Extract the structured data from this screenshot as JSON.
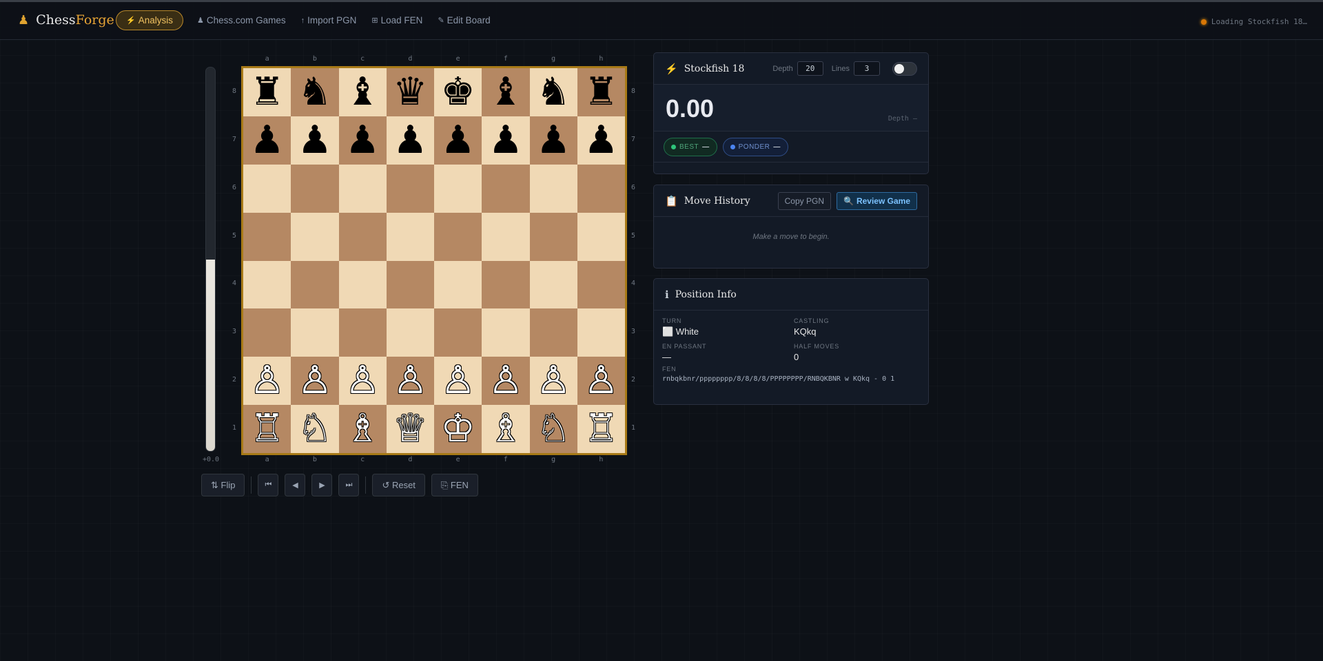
{
  "nav": {
    "brand_icon": "♟",
    "brand_prefix": "Chess",
    "brand_accent": "Forge",
    "items": [
      {
        "icon": "⚡",
        "label": "Analysis"
      },
      {
        "icon": "♟",
        "label": "Chess.com Games"
      },
      {
        "icon": "↑",
        "label": "Import PGN"
      },
      {
        "icon": "⊞",
        "label": "Load FEN"
      },
      {
        "icon": "✎",
        "label": "Edit Board"
      }
    ],
    "status_text": "Loading Stockfish 18…"
  },
  "eval_bar": {
    "white_fraction": 0.5,
    "label": "+0.0"
  },
  "board": {
    "files": [
      "a",
      "b",
      "c",
      "d",
      "e",
      "f",
      "g",
      "h"
    ],
    "ranks": [
      "8",
      "7",
      "6",
      "5",
      "4",
      "3",
      "2",
      "1"
    ],
    "rows": [
      [
        "♜",
        "♞",
        "♝",
        "♛",
        "♚",
        "♝",
        "♞",
        "♜"
      ],
      [
        "♟",
        "♟",
        "♟",
        "♟",
        "♟",
        "♟",
        "♟",
        "♟"
      ],
      [
        "",
        "",
        "",
        "",
        "",
        "",
        "",
        ""
      ],
      [
        "",
        "",
        "",
        "",
        "",
        "",
        "",
        ""
      ],
      [
        "",
        "",
        "",
        "",
        "",
        "",
        "",
        ""
      ],
      [
        "",
        "",
        "",
        "",
        "",
        "",
        "",
        ""
      ],
      [
        "♙",
        "♙",
        "♙",
        "♙",
        "♙",
        "♙",
        "♙",
        "♙"
      ],
      [
        "♖",
        "♘",
        "♗",
        "♕",
        "♔",
        "♗",
        "♘",
        "♖"
      ]
    ]
  },
  "controls": {
    "flip": "⇅ Flip",
    "first": "⏮",
    "prev": "◀",
    "next": "▶",
    "last": "⏭",
    "reset": "↺ Reset",
    "fen": "⎘ FEN"
  },
  "engine": {
    "icon": "⚡",
    "title": "Stockfish 18",
    "depth_label": "Depth",
    "depth_value": "20",
    "lines_label": "Lines",
    "lines_value": "3",
    "score": "0.00",
    "depth_status": "Depth —",
    "best_label": "BEST",
    "best_value": "—",
    "ponder_label": "PONDER",
    "ponder_value": "—"
  },
  "history": {
    "icon": "📋",
    "title": "Move History",
    "copy_pgn": "Copy PGN",
    "review_icon": "🔍",
    "review": "Review Game",
    "empty": "Make a move to begin."
  },
  "position": {
    "icon": "ℹ",
    "title": "Position Info",
    "turn_label": "TURN",
    "turn_value": "⬜ White",
    "castling_label": "CASTLING",
    "castling_value": "KQkq",
    "en_passant_label": "EN PASSANT",
    "en_passant_value": "—",
    "half_moves_label": "HALF MOVES",
    "half_moves_value": "0",
    "fen_label": "FEN",
    "fen_value": "rnbqkbnr/pppppppp/8/8/8/8/PPPPPPPP/RNBQKBNR w KQkq - 0 1"
  }
}
